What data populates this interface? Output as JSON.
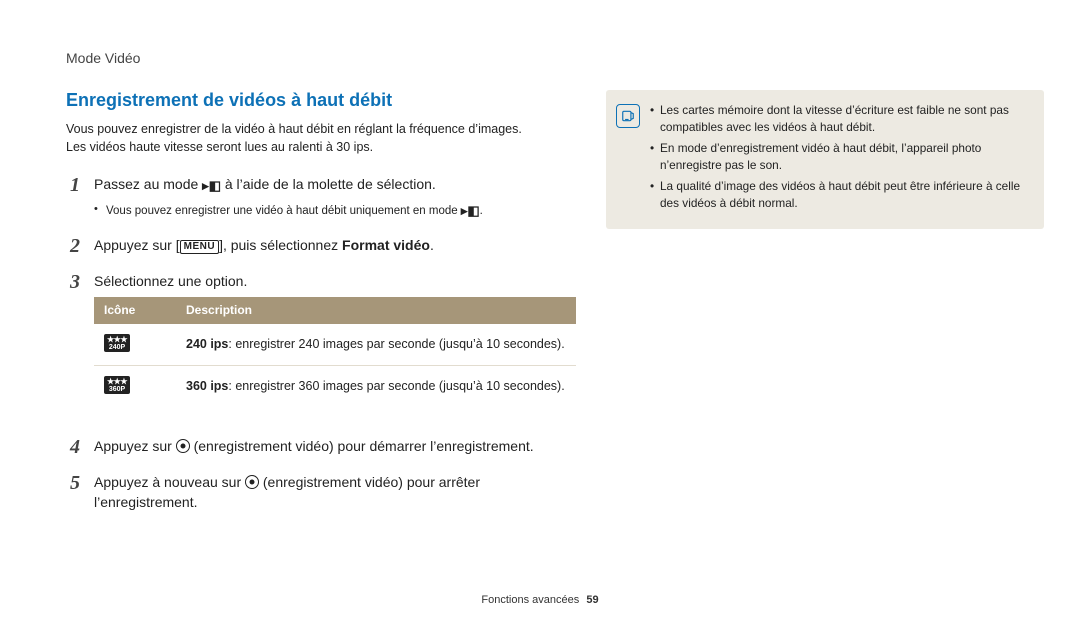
{
  "header": "Mode Vidéo",
  "section_title": "Enregistrement de vidéos à haut débit",
  "intro_line1": "Vous pouvez enregistrer de la vidéo à haut débit en réglant la fréquence d’images.",
  "intro_line2": "Les vidéos haute vitesse seront lues au ralenti à 30 ips.",
  "steps": {
    "s1_pre": "Passez au mode ",
    "s1_post": " à l’aide de la molette de sélection.",
    "s1_sub_pre": "Vous pouvez enregistrer une vidéo à haut débit uniquement en mode ",
    "s1_sub_post": ".",
    "s2_pre": "Appuyez sur [",
    "s2_menu": "MENU",
    "s2_mid": "], puis sélectionnez ",
    "s2_bold": "Format vidéo",
    "s2_post": ".",
    "s3": "Sélectionnez une option.",
    "s4_pre": "Appuyez sur ",
    "s4_post": " (enregistrement vidéo) pour démarrer l’enregistrement.",
    "s5_pre": "Appuyez à nouveau sur ",
    "s5_post": " (enregistrement vidéo) pour arrêter l’enregistrement."
  },
  "table": {
    "col_icon": "Icône",
    "col_desc": "Description",
    "rows": [
      {
        "icon_top": "★★★",
        "icon_bot": "240P",
        "bold": "240 ips",
        "rest": ": enregistrer 240 images par seconde (jusqu’à 10 secondes)."
      },
      {
        "icon_top": "★★★",
        "icon_bot": "360P",
        "bold": "360 ips",
        "rest": ": enregistrer 360 images par seconde (jusqu’à 10 secondes)."
      }
    ]
  },
  "notes": [
    "Les cartes mémoire dont la vitesse d’écriture est faible ne sont pas compatibles avec les vidéos à haut débit.",
    "En mode d’enregistrement vidéo à haut débit, l’appareil photo n’enregistre pas le son.",
    "La qualité d’image des vidéos à haut débit peut être inférieure à celle des vidéos à débit normal."
  ],
  "footer_label": "Fonctions avancées",
  "footer_page": "59",
  "cam_glyph": "▸◧"
}
